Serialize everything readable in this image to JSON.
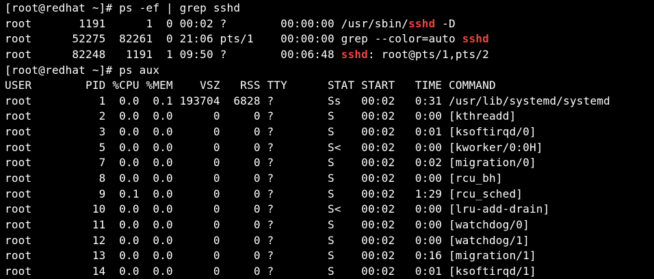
{
  "terminal": {
    "lines": [
      [
        {
          "t": "[root@redhat ~]# ps -ef | grep sshd"
        }
      ],
      [
        {
          "t": "root       1191      1  0 00:02 ?        00:00:00 /usr/sbin/"
        },
        {
          "t": "sshd",
          "hl": true
        },
        {
          "t": " -D"
        }
      ],
      [
        {
          "t": "root      52275  82261  0 21:06 pts/1    00:00:00 grep --color=auto "
        },
        {
          "t": "sshd",
          "hl": true
        }
      ],
      [
        {
          "t": "root      82248   1191  1 09:50 ?        00:06:48 "
        },
        {
          "t": "sshd",
          "hl": true
        },
        {
          "t": ": root@pts/1,pts/2"
        }
      ],
      [
        {
          "t": "[root@redhat ~]# ps aux"
        }
      ],
      [
        {
          "t": "USER        PID %CPU %MEM    VSZ   RSS TTY      STAT START   TIME COMMAND"
        }
      ],
      [
        {
          "t": "root          1  0.0  0.1 193704  6828 ?        Ss   00:02   0:31 /usr/lib/systemd/systemd"
        }
      ],
      [
        {
          "t": "root          2  0.0  0.0      0     0 ?        S    00:02   0:00 [kthreadd]"
        }
      ],
      [
        {
          "t": "root          3  0.0  0.0      0     0 ?        S    00:02   0:01 [ksoftirqd/0]"
        }
      ],
      [
        {
          "t": "root          5  0.0  0.0      0     0 ?        S<   00:02   0:00 [kworker/0:0H]"
        }
      ],
      [
        {
          "t": "root          7  0.0  0.0      0     0 ?        S    00:02   0:02 [migration/0]"
        }
      ],
      [
        {
          "t": "root          8  0.0  0.0      0     0 ?        S    00:02   0:00 [rcu_bh]"
        }
      ],
      [
        {
          "t": "root          9  0.1  0.0      0     0 ?        S    00:02   1:29 [rcu_sched]"
        }
      ],
      [
        {
          "t": "root         10  0.0  0.0      0     0 ?        S<   00:02   0:00 [lru-add-drain]"
        }
      ],
      [
        {
          "t": "root         11  0.0  0.0      0     0 ?        S    00:02   0:00 [watchdog/0]"
        }
      ],
      [
        {
          "t": "root         12  0.0  0.0      0     0 ?        S    00:02   0:00 [watchdog/1]"
        }
      ],
      [
        {
          "t": "root         13  0.0  0.0      0     0 ?        S    00:02   0:16 [migration/1]"
        }
      ],
      [
        {
          "t": "root         14  0.0  0.0      0     0 ?        S    00:02   0:01 [ksoftirqd/1]"
        }
      ]
    ]
  },
  "colors": {
    "background": "#000000",
    "foreground": "#ffffff",
    "highlight": "#ef4444"
  }
}
